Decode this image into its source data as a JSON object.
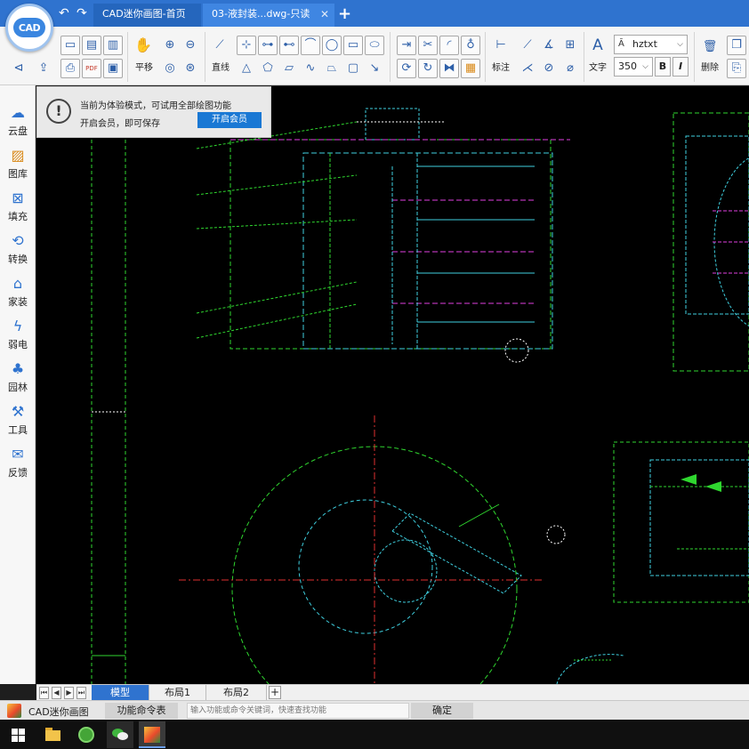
{
  "titlebar": {
    "logo_text": "CAD",
    "tabs": [
      {
        "label": "CAD迷你画图-首页"
      },
      {
        "label": "03-液封装...dwg-只读"
      }
    ],
    "close_glyph": "✕",
    "add_glyph": "+"
  },
  "ribbon": {
    "pan_label": "平移",
    "line_label": "直线",
    "dimension_label": "标注",
    "text_label": "文字",
    "delete_label": "删除",
    "font_name": "hztxt",
    "font_size": "350",
    "bold_label": "B",
    "italic_label": "I"
  },
  "sidebar": {
    "items": [
      {
        "label": "云盘",
        "icon": "cloud-icon"
      },
      {
        "label": "图库",
        "icon": "gallery-icon"
      },
      {
        "label": "填充",
        "icon": "fill-icon"
      },
      {
        "label": "转换",
        "icon": "convert-icon"
      },
      {
        "label": "家装",
        "icon": "home-decor-icon"
      },
      {
        "label": "弱电",
        "icon": "low-voltage-icon"
      },
      {
        "label": "园林",
        "icon": "garden-icon"
      },
      {
        "label": "工具",
        "icon": "tools-icon"
      },
      {
        "label": "反馈",
        "icon": "feedback-icon"
      }
    ]
  },
  "notice": {
    "icon": "!",
    "line1": "当前为体验模式，可试用全部绘图功能",
    "line2": "开启会员，即可保存",
    "button_label": "开启会员"
  },
  "layout_tabs": {
    "tabs": [
      "模型",
      "布局1",
      "布局2"
    ],
    "add_glyph": "+"
  },
  "command_bar": {
    "app_name": "CAD迷你画图",
    "function_table_label": "功能命令表",
    "input_placeholder": "输入功能或命令关键词，快速查找功能",
    "ok_label": "确定"
  },
  "colors": {
    "accent": "#2f73cf",
    "canvas_bg": "#000000",
    "drawing_green": "#2fd62f",
    "drawing_cyan": "#3fd0e0",
    "drawing_magenta": "#e040e0",
    "drawing_red": "#e03030"
  }
}
